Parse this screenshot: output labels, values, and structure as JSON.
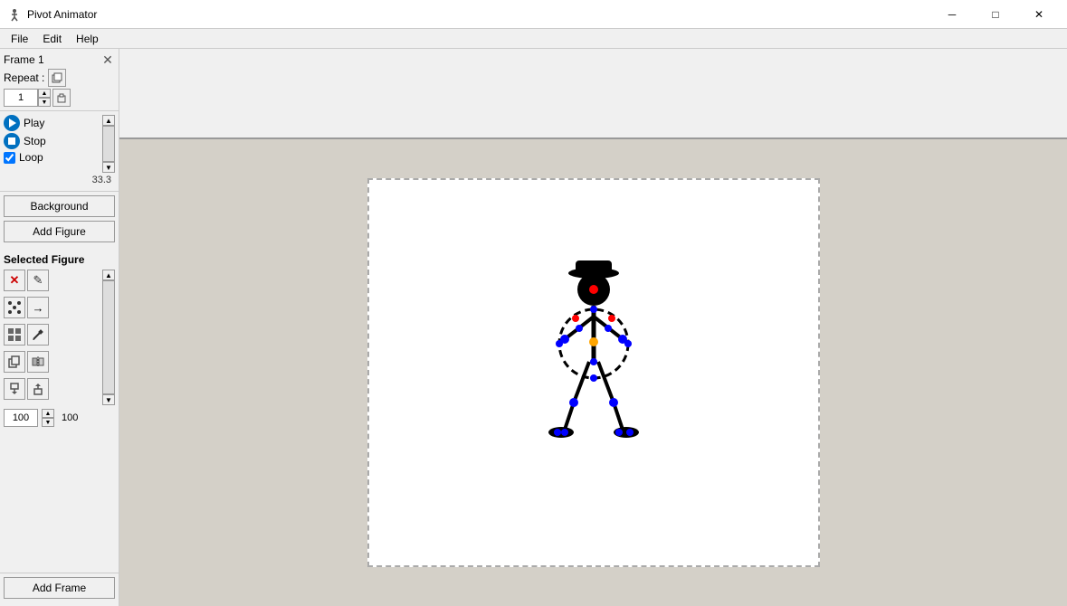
{
  "titleBar": {
    "appName": "Pivot Animator",
    "minBtn": "─",
    "maxBtn": "□",
    "closeBtn": "✕"
  },
  "menuBar": {
    "items": [
      "File",
      "Edit",
      "Help"
    ]
  },
  "framesPanel": {
    "frameLabel": "Frame 1",
    "repeatLabel": "Repeat :",
    "repeatValue": "1"
  },
  "controls": {
    "playLabel": "Play",
    "stopLabel": "Stop",
    "loopLabel": "Loop",
    "fpsValue": "33.3"
  },
  "buttons": {
    "backgroundLabel": "Background",
    "addFigureLabel": "Add Figure",
    "addFrameLabel": "Add Frame"
  },
  "selectedFigure": {
    "title": "Selected Figure",
    "sizeValue": "100",
    "sizeMax": "100"
  },
  "tools": {
    "delete": "✕",
    "edit": "✎",
    "dots1": "⠿",
    "arrow": "→",
    "grid1": "⊞",
    "pointer": "↖",
    "copyFig": "⧉",
    "mirror": "⇔",
    "copyDown": "⬇",
    "pasteDown": "⬆"
  }
}
